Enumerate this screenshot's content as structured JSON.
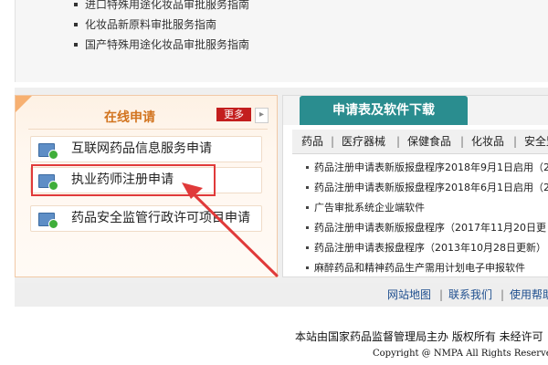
{
  "top_list": [
    "进口特殊用途化妆品审批服务指南",
    "化妆品新原料审批服务指南",
    "国产特殊用途化妆品审批服务指南"
  ],
  "online_apply": {
    "title": "在线申请",
    "more_label": "更多",
    "more_arrow": "▸",
    "items": [
      "互联网药品信息服务申请",
      "执业药师注册申请",
      "药品安全监管行政许可项目申请"
    ]
  },
  "downloads": {
    "tab_title": "申请表及软件下载",
    "categories": [
      "药品",
      "医疗器械",
      "保健食品",
      "化妆品",
      "安全监管"
    ],
    "separator": "|",
    "items": [
      "药品注册申请表新版报盘程序2018年9月1日启用（2",
      "药品注册申请表新版报盘程序2018年6月1日启用（2",
      "广告审批系统企业端软件",
      "药品注册申请表新版报盘程序（2017年11月20日更",
      "药品注册申请表报盘程序（2013年10月28日更新）",
      "麻醉药品和精神药品生产需用计划电子申报软件"
    ]
  },
  "footer_links": [
    "网站地图",
    "联系我们",
    "使用帮助"
  ],
  "copyright_line1": "本站由国家药品监督管理局主办 版权所有 未经许可",
  "copyright_line2": "Copyright @ NMPA All Rights Reserved",
  "colors": {
    "accent_orange": "#d2741f",
    "tab_teal": "#2a8d8f",
    "more_red": "#c31e1e",
    "annotation_red": "#e03a3a",
    "link_blue": "#1f4f8f"
  }
}
